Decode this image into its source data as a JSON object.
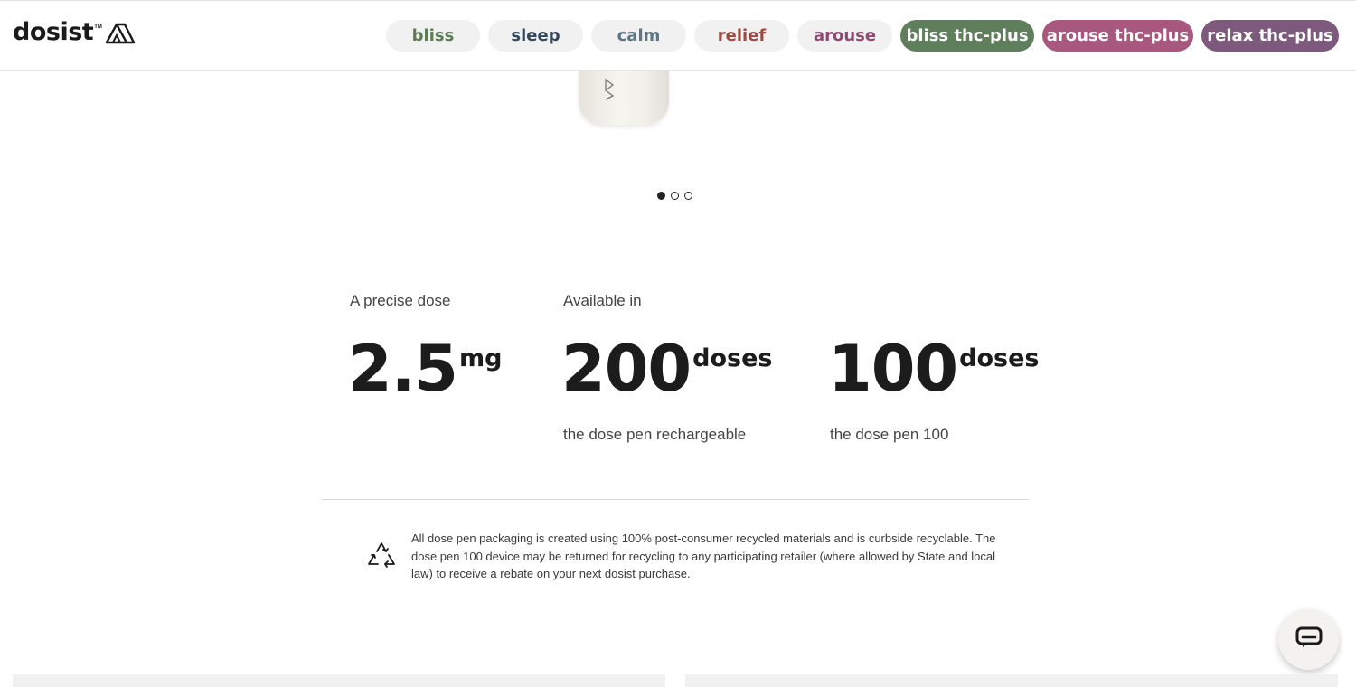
{
  "brand": {
    "name": "dosist",
    "tm": "TM"
  },
  "nav": [
    {
      "label": "bliss",
      "color": "#5d7b55",
      "bg": "#f1f1f1"
    },
    {
      "label": "sleep",
      "color": "#33465c",
      "bg": "#f1f1f1"
    },
    {
      "label": "calm",
      "color": "#5e7684",
      "bg": "#f1f1f1"
    },
    {
      "label": "relief",
      "color": "#9c4a43",
      "bg": "#f1f1f1"
    },
    {
      "label": "arouse",
      "color": "#8e4b72",
      "bg": "#f1f1f1"
    },
    {
      "label": "bliss thc-plus",
      "color": "#ffffff",
      "bg": "#5f7e5c"
    },
    {
      "label": "arouse thc-plus",
      "color": "#ffffff",
      "bg": "#a8577f"
    },
    {
      "label": "relax thc-plus",
      "color": "#ffffff",
      "bg": "#7d5a7d"
    }
  ],
  "carousel": {
    "slides": 3,
    "active_index": 0
  },
  "stats": {
    "dose": {
      "label": "A precise dose",
      "value": "2.5",
      "unit": "mg"
    },
    "available_label": "Available in",
    "rechargeable": {
      "value": "200",
      "unit": "doses",
      "caption": "the dose pen rechargeable"
    },
    "pen100": {
      "value": "100",
      "unit": "doses",
      "caption": "the dose pen 100"
    }
  },
  "recycling_note": "All dose pen packaging is created using 100% post-consumer recycled materials and is curbside recyclable. The dose pen 100 device may be returned for recycling to any participating retailer (where allowed by State and local law) to receive a rebate on your next dosist purchase.",
  "icons": {
    "logo_mark": "mountain-logo-icon",
    "recycle": "recycle-icon",
    "chat": "chat-icon"
  }
}
